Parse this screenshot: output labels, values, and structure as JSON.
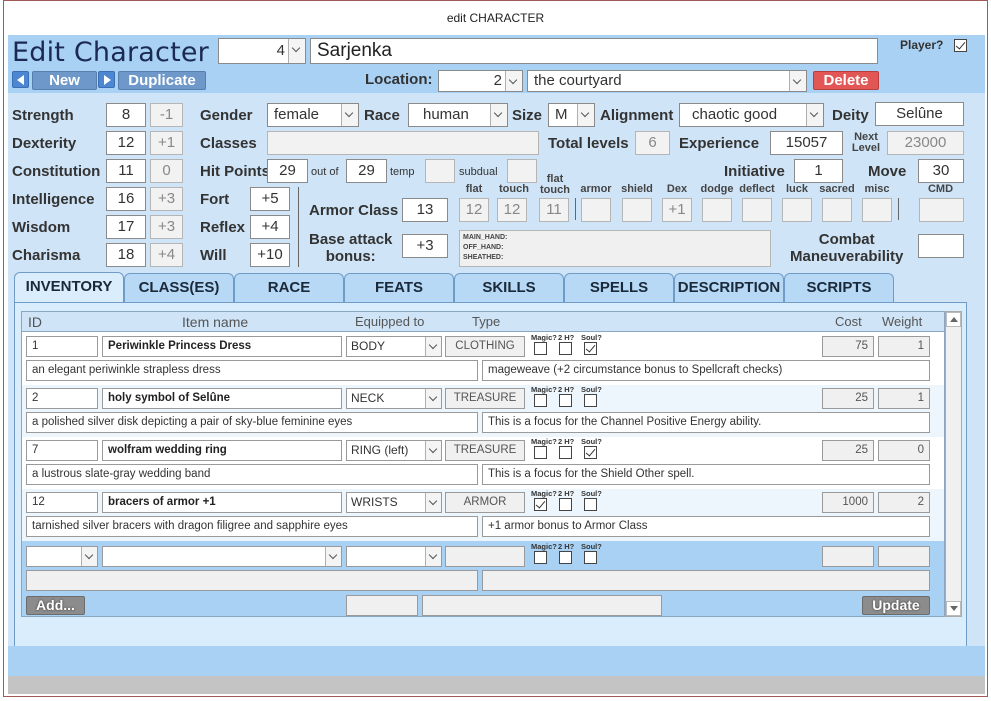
{
  "window": {
    "title": "edit CHARACTER"
  },
  "header": {
    "heading": "Edit Character",
    "char_id": "4",
    "char_name": "Sarjenka",
    "player_label": "Player?",
    "player_checked": true,
    "new_label": "New",
    "duplicate_label": "Duplicate",
    "location_label": "Location:",
    "location_id": "2",
    "location_name": "the courtyard",
    "delete_label": "Delete"
  },
  "abilities": [
    {
      "name": "Strength",
      "score": "8",
      "mod": "-1"
    },
    {
      "name": "Dexterity",
      "score": "12",
      "mod": "+1"
    },
    {
      "name": "Constitution",
      "score": "11",
      "mod": "0"
    },
    {
      "name": "Intelligence",
      "score": "16",
      "mod": "+3"
    },
    {
      "name": "Wisdom",
      "score": "17",
      "mod": "+3"
    },
    {
      "name": "Charisma",
      "score": "18",
      "mod": "+4"
    }
  ],
  "identity": {
    "gender_label": "Gender",
    "gender": "female",
    "race_label": "Race",
    "race": "human",
    "size_label": "Size",
    "size": "M",
    "alignment_label": "Alignment",
    "alignment": "chaotic good",
    "deity_label": "Deity",
    "deity": "Selûne",
    "classes_label": "Classes",
    "classes": "",
    "total_levels_label": "Total levels",
    "total_levels": "6",
    "experience_label": "Experience",
    "experience": "15057",
    "next_level_label_1": "Next",
    "next_level_label_2": "Level",
    "next_level": "23000"
  },
  "hp": {
    "label": "Hit Points",
    "current": "29",
    "out_of_label": "out of",
    "max": "29",
    "temp_label": "temp",
    "temp": "",
    "subdual_label": "subdual",
    "subdual": ""
  },
  "initiative": {
    "label": "Initiative",
    "value": "1"
  },
  "move": {
    "label": "Move",
    "value": "30"
  },
  "saves": [
    {
      "name": "Fort",
      "value": "+5"
    },
    {
      "name": "Reflex",
      "value": "+4"
    },
    {
      "name": "Will",
      "value": "+10"
    }
  ],
  "armor": {
    "label": "Armor Class",
    "value": "13",
    "flat_label": "flat",
    "flat": "12",
    "touch_label": "touch",
    "touch": "12",
    "flat_touch_label_1": "flat",
    "flat_touch_label_2": "touch",
    "flat_touch": "11",
    "armor_label": "armor",
    "armor_val": "",
    "shield_label": "shield",
    "shield_val": "",
    "dex_label": "Dex",
    "dex_val": "+1",
    "dodge_label": "dodge",
    "dodge_val": "",
    "deflect_label": "deflect",
    "deflect_val": "",
    "luck_label": "luck",
    "luck_val": "",
    "sacred_label": "sacred",
    "sacred_val": "",
    "misc_label": "misc",
    "misc_val": "",
    "cmd_label": "CMD",
    "cmd_val": ""
  },
  "bab": {
    "label_1": "Base attack",
    "label_2": "bonus:",
    "value": "+3",
    "hands": [
      "MAIN_HAND:",
      "OFF_HAND:",
      "SHEATHED:"
    ]
  },
  "cmb": {
    "label_1": "Combat",
    "label_2": "Maneuverability",
    "value": ""
  },
  "tabs": [
    "INVENTORY",
    "CLASS(ES)",
    "RACE",
    "FEATS",
    "SKILLS",
    "SPELLS",
    "DESCRIPTION",
    "SCRIPTS"
  ],
  "inventory": {
    "columns": {
      "id": "ID",
      "name": "Item name",
      "equipped": "Equipped to",
      "type": "Type",
      "cost": "Cost",
      "weight": "Weight"
    },
    "flag_labels": {
      "magic": "Magic?",
      "two_hand": "2 H?",
      "soul": "Soul?"
    },
    "items": [
      {
        "id": "1",
        "name": "Periwinkle Princess Dress",
        "equipped": "BODY",
        "type": "CLOTHING",
        "magic": false,
        "two_hand": false,
        "soul": true,
        "cost": "75",
        "weight": "1",
        "desc": "an elegant periwinkle strapless dress",
        "notes": "mageweave (+2 circumstance bonus to Spellcraft checks)"
      },
      {
        "id": "2",
        "name": "holy symbol of Selûne",
        "equipped": "NECK",
        "type": "TREASURE",
        "magic": false,
        "two_hand": false,
        "soul": false,
        "cost": "25",
        "weight": "1",
        "desc": "a polished silver disk depicting a pair of sky-blue feminine eyes",
        "notes": "This is a focus for the Channel Positive Energy ability."
      },
      {
        "id": "7",
        "name": "wolfram wedding ring",
        "equipped": "RING (left)",
        "type": "TREASURE",
        "magic": false,
        "two_hand": false,
        "soul": true,
        "cost": "25",
        "weight": "0",
        "desc": "a lustrous slate-gray wedding band",
        "notes": "This is a focus for the Shield Other spell."
      },
      {
        "id": "12",
        "name": "bracers of armor +1",
        "equipped": "WRISTS",
        "type": "ARMOR",
        "magic": true,
        "two_hand": false,
        "soul": false,
        "cost": "1000",
        "weight": "2",
        "desc": "tarnished silver bracers with dragon filigree and sapphire eyes",
        "notes": "+1 armor bonus to Armor Class"
      }
    ],
    "add_label": "Add...",
    "update_label": "Update"
  },
  "icons": {
    "prev": "arrow-left-icon",
    "next": "arrow-right-icon",
    "dropdown": "chevron-down-icon"
  },
  "colors": {
    "header": "#a9d1f4",
    "panel": "#cfe4f7",
    "accent": "#6d98c9",
    "delete": "#e25656"
  }
}
